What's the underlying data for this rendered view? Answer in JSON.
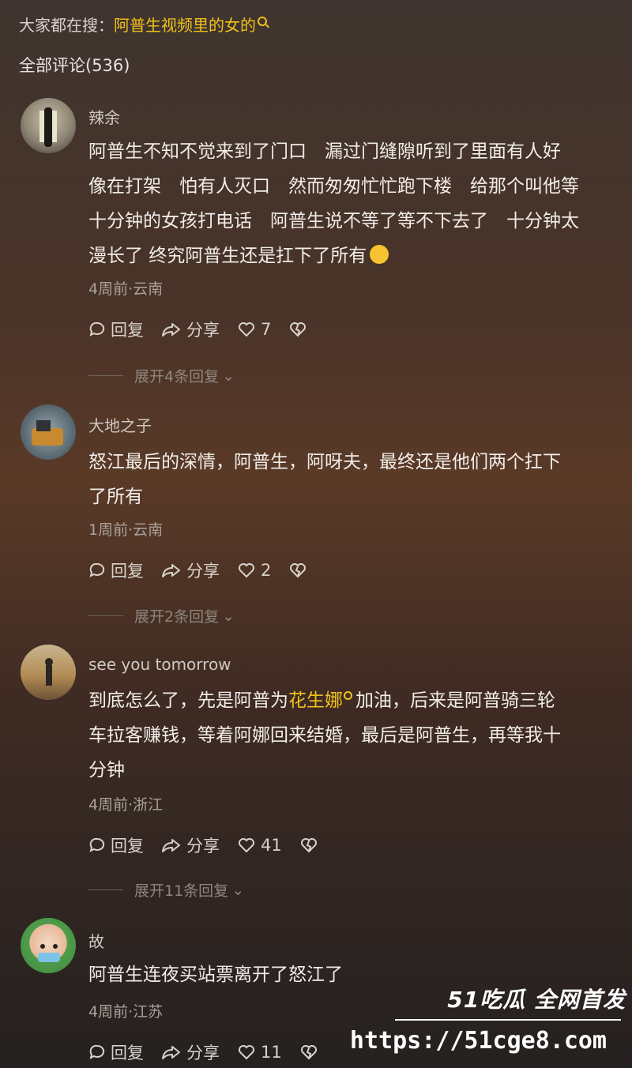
{
  "header": {
    "search_prefix": "大家都在搜：",
    "search_keyword": "阿普生视频里的女的",
    "comment_count_label": "全部评论(536)"
  },
  "actions": {
    "reply": "回复",
    "share": "分享"
  },
  "comments": [
    {
      "user": "辣余",
      "text_lines": [
        "阿普生不知不觉来到了门口　漏过门缝隙听到了里面有人好",
        "像在打架　怕有人灭口　然而匆匆忙忙跑下楼　给那个叫他等",
        "十分钟的女孩打电话　阿普生说不等了等不下去了　十分钟太",
        "漫长了 终究阿普生还是扛下了所有"
      ],
      "meta": "4周前·云南",
      "likes": "7",
      "expand": "展开4条回复"
    },
    {
      "user": "大地之子",
      "text_lines": [
        "怒江最后的深情，阿普生，阿呀夫，最终还是他们两个扛下",
        "了所有"
      ],
      "meta": "1周前·云南",
      "likes": "2",
      "expand": "展开2条回复"
    },
    {
      "user": "see you tomorrow",
      "text_line1_a": "到底怎么了，先是阿普为",
      "text_line1_kw": "花生娜",
      "text_line1_b": "加油，后来是阿普骑三轮",
      "text_lines_rest": [
        "车拉客赚钱，等着阿娜回来结婚，最后是阿普生，再等我十",
        "分钟"
      ],
      "meta": "4周前·浙江",
      "likes": "41",
      "expand": "展开11条回复"
    },
    {
      "user": "故",
      "text_lines": [
        "阿普生连夜买站票离开了怒江了"
      ],
      "meta": "4周前·江苏",
      "likes": "11"
    }
  ],
  "watermark": {
    "line1": "51吃瓜 全网首发",
    "line2": "https://51cge8.com"
  }
}
